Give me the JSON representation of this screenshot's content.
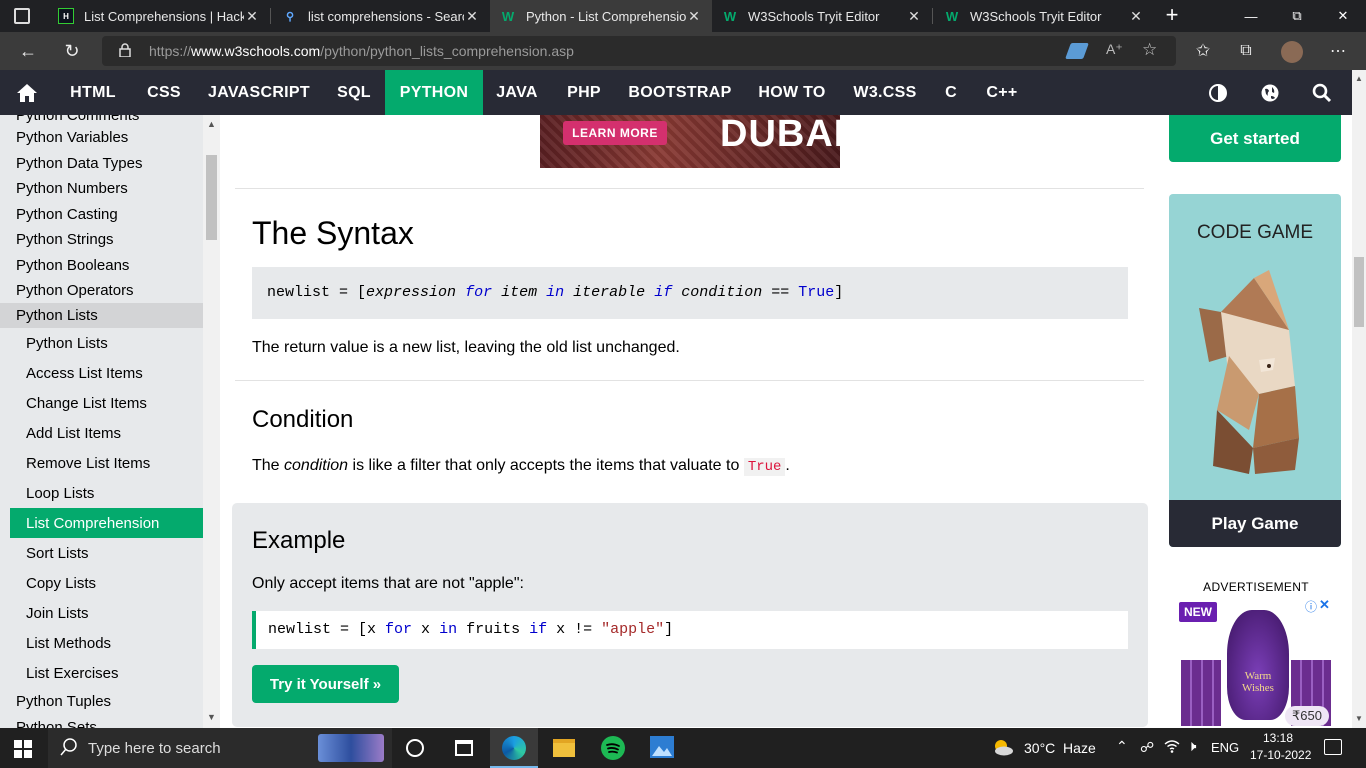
{
  "browser": {
    "tabs": [
      {
        "title": "List Comprehensions | Hacker",
        "favicon": "HR"
      },
      {
        "title": "list comprehensions - Search",
        "favicon": "search-icon"
      },
      {
        "title": "Python - List Comprehension",
        "favicon": "W"
      },
      {
        "title": "W3Schools Tryit Editor",
        "favicon": "W"
      },
      {
        "title": "W3Schools Tryit Editor",
        "favicon": "W"
      }
    ],
    "url_prefix": "https://",
    "url_host": "www.w3schools.com",
    "url_path": "/python/python_lists_comprehension.asp"
  },
  "topnav": {
    "items": [
      "HTML",
      "CSS",
      "JAVASCRIPT",
      "SQL",
      "PYTHON",
      "JAVA",
      "PHP",
      "BOOTSTRAP",
      "HOW TO",
      "W3.CSS",
      "C",
      "C++"
    ],
    "active": "PYTHON"
  },
  "sidebar": {
    "partial_top": "Python Comments",
    "items": [
      "Python Variables",
      "Python Data Types",
      "Python Numbers",
      "Python Casting",
      "Python Strings",
      "Python Booleans",
      "Python Operators",
      "Python Lists"
    ],
    "subitems": [
      "Python Lists",
      "Access List Items",
      "Change List Items",
      "Add List Items",
      "Remove List Items",
      "Loop Lists",
      "List Comprehension",
      "Sort Lists",
      "Copy Lists",
      "Join Lists",
      "List Methods",
      "List Exercises"
    ],
    "after": [
      "Python Tuples",
      "Python Sets"
    ]
  },
  "ad_top": {
    "button": "LEARN MORE",
    "brand": "DUBAI"
  },
  "content": {
    "syntax_heading": "The Syntax",
    "syntax_code": {
      "prefix": "newlist = [",
      "expression": "expression",
      "for": "for",
      "item": "item",
      "in": "in",
      "iterable": "iterable",
      "if": "if",
      "condition": "condition",
      "eq": "==",
      "true": "True",
      "close": "]"
    },
    "return_text": "The return value is a new list, leaving the old list unchanged.",
    "condition_heading": "Condition",
    "condition_text_1": "The ",
    "condition_em": "condition",
    "condition_text_2": " is like a filter that only accepts the items that valuate to ",
    "condition_code": "True",
    "condition_text_3": ".",
    "example_heading": "Example",
    "example_text": "Only accept items that are not \"apple\":",
    "example_code": {
      "p1": "newlist = [x ",
      "for": "for",
      "p2": " x ",
      "in": "in",
      "p3": " fruits ",
      "if": "if",
      "p4": " x != ",
      "str": "\"apple\"",
      "p5": "]"
    },
    "try_button": "Try it Yourself »"
  },
  "right": {
    "get_started": "Get started",
    "code_game": "CODE GAME",
    "play_game": "Play Game",
    "advertisement": "ADVERTISEMENT",
    "ad_badge": "NEW",
    "ad_text": "Warm Wishes",
    "ad_price": "₹650"
  },
  "taskbar": {
    "search_placeholder": "Type here to search",
    "weather": "30°C  Haze",
    "lang": "ENG",
    "time": "13:18",
    "date": "17-10-2022"
  },
  "colors": {
    "accent": "#04aa6d",
    "nav": "#282a35",
    "sidebar": "#e7e9eb"
  }
}
